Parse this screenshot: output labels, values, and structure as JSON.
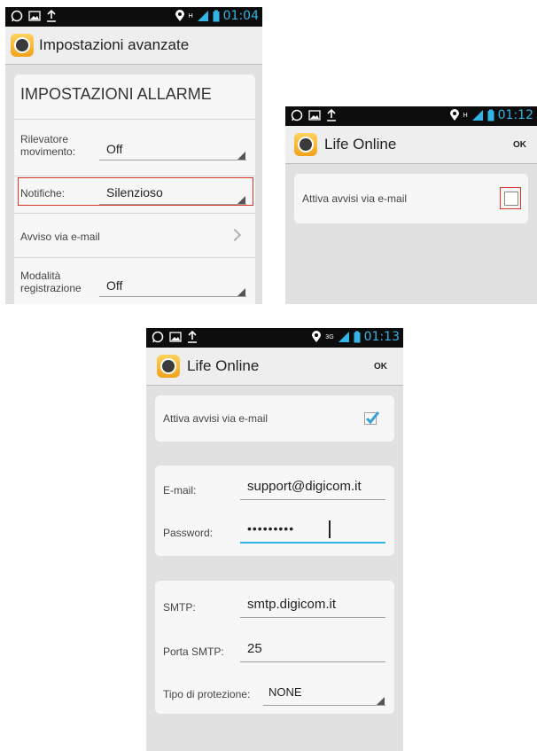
{
  "screen1": {
    "status_time": "01:04",
    "net_label": "H",
    "title": "Impostazioni avanzate",
    "section_header": "IMPOSTAZIONI ALLARME",
    "rows": [
      {
        "label": "Rilevatore movimento:",
        "value": "Off"
      },
      {
        "label": "Notifiche:",
        "value": "Silenzioso"
      },
      {
        "label": "Avviso via e-mail"
      },
      {
        "label": "Modalità registrazione",
        "value": "Off"
      }
    ]
  },
  "screen2": {
    "status_time": "01:12",
    "net_label": "H",
    "title": "Life Online",
    "ok_label": "OK",
    "option_label": "Attiva avvisi via e-mail",
    "checked": false
  },
  "screen3": {
    "status_time": "01:13",
    "net_label": "3G",
    "title": "Life Online",
    "ok_label": "OK",
    "option_label": "Attiva avvisi via e-mail",
    "checked": true,
    "email_label": "E-mail:",
    "email_value": "support@digicom.it",
    "password_label": "Password:",
    "password_value": "•••••••••",
    "smtp_label": "SMTP:",
    "smtp_value": "smtp.digicom.it",
    "port_label": "Porta SMTP:",
    "port_value": "25",
    "protection_label": "Tipo di protezione:",
    "protection_value": "NONE"
  },
  "colors": {
    "accent": "#33b5e5",
    "highlight": "#d9362a",
    "check": "#3aa0dd"
  },
  "icons": [
    "whatsapp-icon",
    "gallery-icon",
    "upload-icon",
    "location-icon",
    "signal-icon",
    "battery-icon",
    "app-icon",
    "chevron-right-icon",
    "checkmark-icon",
    "dropdown-arrow-icon"
  ]
}
